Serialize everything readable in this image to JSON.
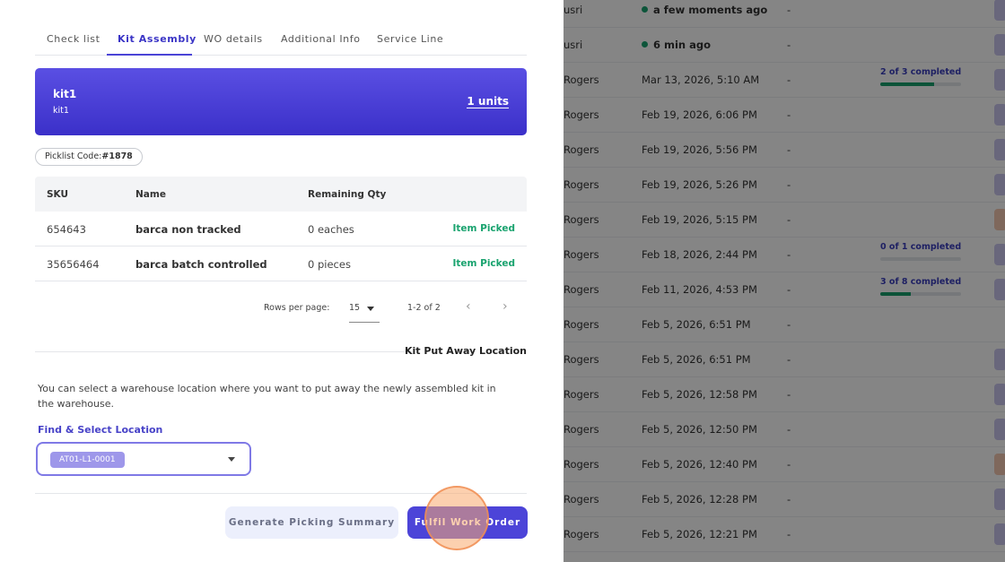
{
  "tabs": [
    {
      "label": "Check list"
    },
    {
      "label": "Kit Assembly",
      "active": true
    },
    {
      "label": "WO details"
    },
    {
      "label": "Additional Info"
    },
    {
      "label": "Service Line"
    }
  ],
  "kit": {
    "name": "kit1",
    "subtitle": "kit1",
    "units": "1 units"
  },
  "picklist": {
    "label": "Picklist Code:",
    "code": "#1878"
  },
  "table": {
    "headers": [
      "SKU",
      "Name",
      "Remaining Qty"
    ],
    "rows": [
      {
        "sku": "654643",
        "name": "barca non tracked",
        "qty": "0 eaches",
        "status": "Item Picked"
      },
      {
        "sku": "35656464",
        "name": "barca batch controlled",
        "qty": "0 pieces",
        "status": "Item Picked"
      }
    ]
  },
  "pagination": {
    "rows_per_page_label": "Rows per page:",
    "rows_per_page": "15",
    "range": "1-2 of 2"
  },
  "putaway": {
    "title": "Kit Put Away Location",
    "description": "You can select a warehouse location where you want to put away the newly assembled kit in the warehouse.",
    "find_label": "Find & Select Location",
    "selected_location": "AT01-L1-0001"
  },
  "buttons": {
    "summary": "Generate Picking Summary",
    "fulfil": "Fulfil Work Order"
  },
  "colors": {
    "accent": "#4c44d8",
    "success": "#1aa36f"
  },
  "background_list": [
    {
      "owner": "usri",
      "date": "a few moments ago",
      "dash": "-",
      "dot": true
    },
    {
      "owner": "usri",
      "date": "6 min ago",
      "dash": "-",
      "dot": true
    },
    {
      "owner": "Rogers",
      "date": "Mar 13, 2026, 5:10 AM",
      "dash": "-",
      "progress": "2 of 3 completed",
      "progress_value": 0.67
    },
    {
      "owner": "Rogers",
      "date": "Feb 19, 2026, 6:06 PM",
      "dash": "-"
    },
    {
      "owner": "Rogers",
      "date": "Feb 19, 2026, 5:56 PM",
      "dash": "-"
    },
    {
      "owner": "Rogers",
      "date": "Feb 19, 2026, 5:26 PM",
      "dash": "-"
    },
    {
      "owner": "Rogers",
      "date": "Feb 19, 2026, 5:15 PM",
      "dash": "-"
    },
    {
      "owner": "Rogers",
      "date": "Feb 18, 2026, 2:44 PM",
      "dash": "-",
      "progress": "0 of 1 completed",
      "progress_value": 0
    },
    {
      "owner": "Rogers",
      "date": "Feb 11, 2026, 4:53 PM",
      "dash": "-",
      "progress": "3 of 8 completed",
      "progress_value": 0.375
    },
    {
      "owner": "Rogers",
      "date": "Feb 5, 2026, 6:51 PM",
      "dash": "-"
    },
    {
      "owner": "Rogers",
      "date": "Feb 5, 2026, 6:51 PM",
      "dash": "-"
    },
    {
      "owner": "Rogers",
      "date": "Feb 5, 2026, 12:58 PM",
      "dash": "-"
    },
    {
      "owner": "Rogers",
      "date": "Feb 5, 2026, 12:50 PM",
      "dash": "-"
    },
    {
      "owner": "Rogers",
      "date": "Feb 5, 2026, 12:40 PM",
      "dash": "-"
    },
    {
      "owner": "Rogers",
      "date": "Feb 5, 2026, 12:28 PM",
      "dash": "-"
    },
    {
      "owner": "Rogers",
      "date": "Feb 5, 2026, 12:21 PM",
      "dash": "-"
    }
  ]
}
